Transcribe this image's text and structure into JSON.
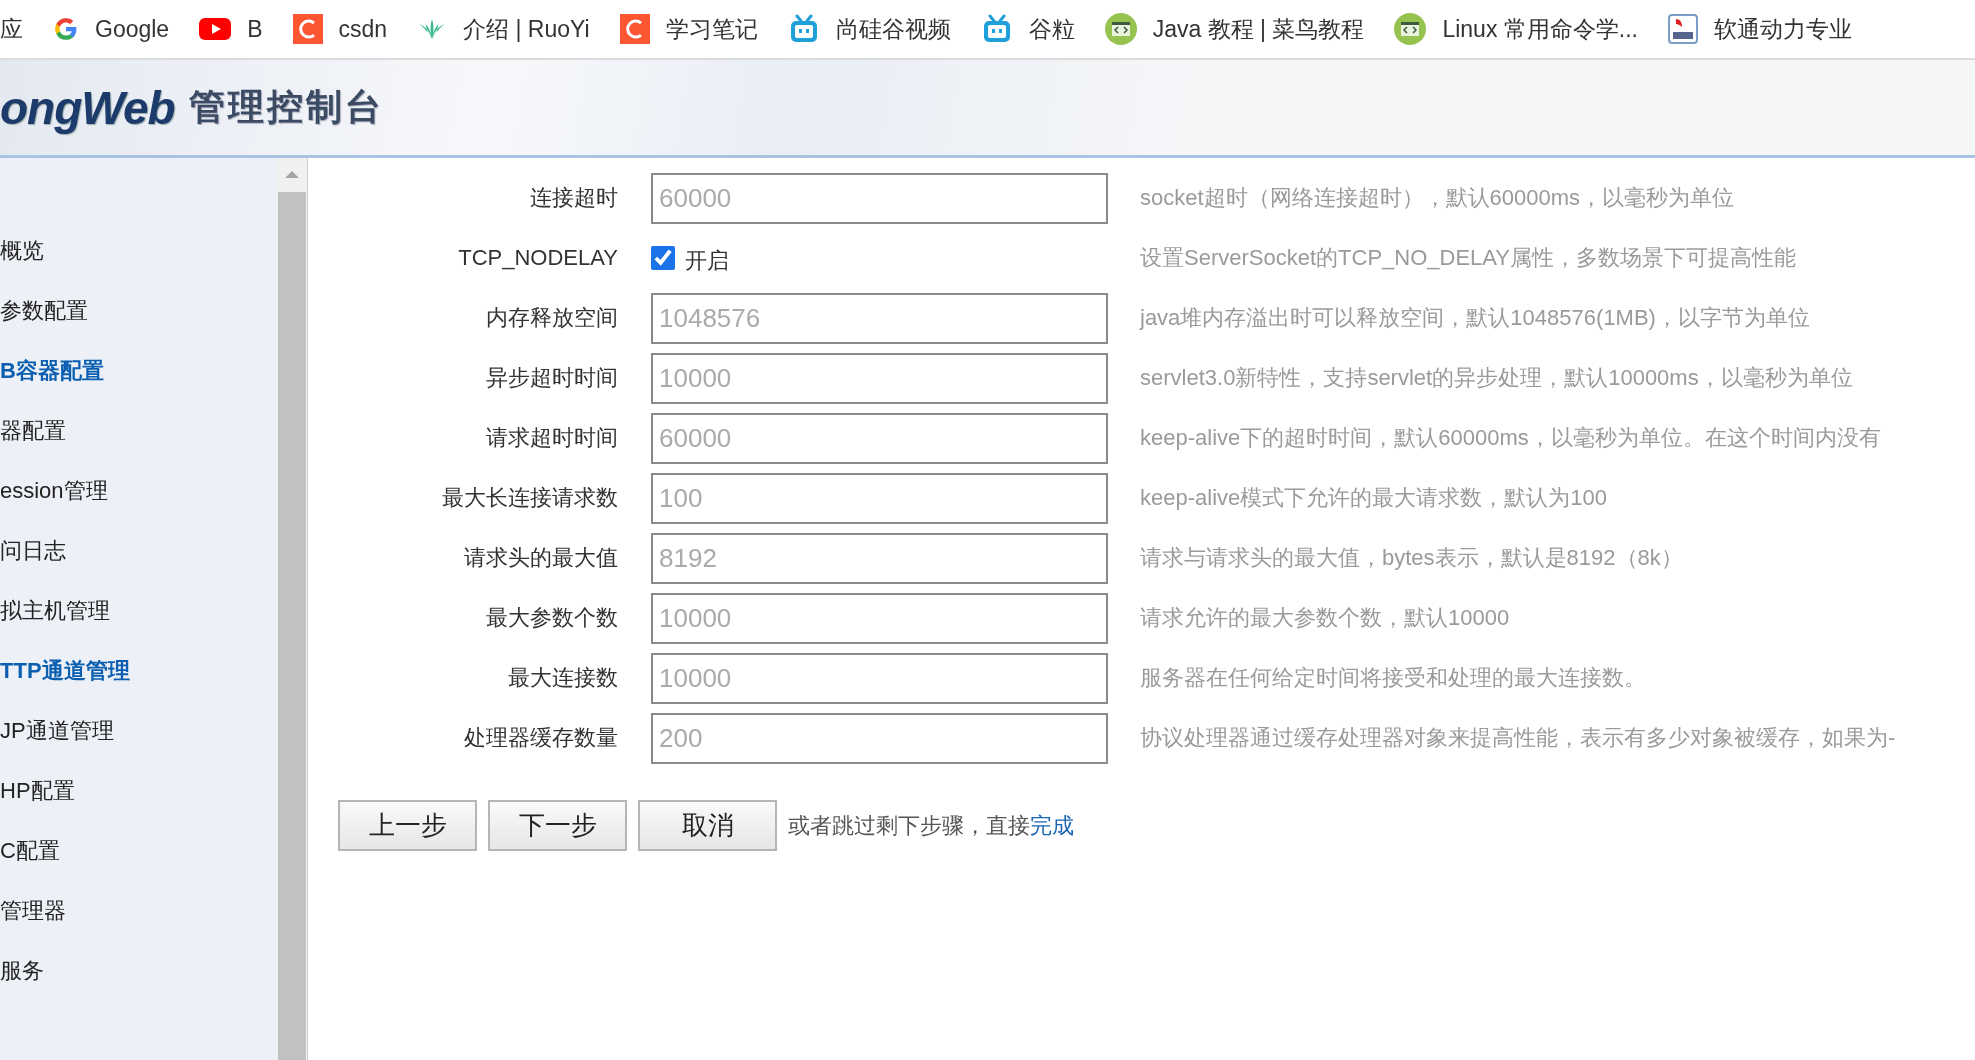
{
  "bookmarks": [
    {
      "label": "应"
    },
    {
      "label": "Google",
      "kind": "google"
    },
    {
      "label": "B",
      "kind": "youtube"
    },
    {
      "label": "csdn",
      "kind": "csdn"
    },
    {
      "label": "介绍 | RuoYi",
      "kind": "leaf"
    },
    {
      "label": "学习笔记",
      "kind": "csdn"
    },
    {
      "label": "尚硅谷视频",
      "kind": "tv"
    },
    {
      "label": "谷粒",
      "kind": "tv"
    },
    {
      "label": "Java 教程 | 菜鸟教程",
      "kind": "code"
    },
    {
      "label": "Linux 常用命令学...",
      "kind": "code"
    },
    {
      "label": "软通动力专业",
      "kind": "psa"
    }
  ],
  "header": {
    "logo": "ongWeb",
    "title": "管理控制台"
  },
  "sidebar": {
    "items": [
      {
        "label": "概览",
        "kind": "item"
      },
      {
        "label": "参数配置",
        "kind": "item"
      },
      {
        "label": "B容器配置",
        "kind": "group"
      },
      {
        "label": "器配置",
        "kind": "item"
      },
      {
        "label": "ession管理",
        "kind": "item"
      },
      {
        "label": "问日志",
        "kind": "item"
      },
      {
        "label": "拟主机管理",
        "kind": "item"
      },
      {
        "label": "TTP通道管理",
        "kind": "group"
      },
      {
        "label": "JP通道管理",
        "kind": "item"
      },
      {
        "label": "HP配置",
        "kind": "item"
      },
      {
        "label": "C配置",
        "kind": "item"
      },
      {
        "label": "管理器",
        "kind": "item"
      },
      {
        "label": "服务",
        "kind": "item"
      }
    ]
  },
  "form": {
    "rows": [
      {
        "kind": "field",
        "label": "连接超时",
        "value": "60000",
        "hint": "socket超时（网络连接超时），默认60000ms，以毫秒为单位"
      },
      {
        "kind": "checkbox",
        "label": "TCP_NODELAY",
        "checked": true,
        "option": "开启",
        "hint": "设置ServerSocket的TCP_NO_DELAY属性，多数场景下可提高性能"
      },
      {
        "kind": "field",
        "label": "内存释放空间",
        "value": "1048576",
        "hint": "java堆内存溢出时可以释放空间，默认1048576(1MB)，以字节为单位"
      },
      {
        "kind": "field",
        "label": "异步超时时间",
        "value": "10000",
        "hint": "servlet3.0新特性，支持servlet的异步处理，默认10000ms，以毫秒为单位"
      },
      {
        "kind": "field",
        "label": "请求超时时间",
        "value": "60000",
        "hint": "keep-alive下的超时时间，默认60000ms，以毫秒为单位。在这个时间内没有"
      },
      {
        "kind": "field",
        "label": "最大长连接请求数",
        "value": "100",
        "hint": "keep-alive模式下允许的最大请求数，默认为100"
      },
      {
        "kind": "field",
        "label": "请求头的最大值",
        "value": "8192",
        "hint": "请求与请求头的最大值，bytes表示，默认是8192（8k）"
      },
      {
        "kind": "field",
        "label": "最大参数个数",
        "value": "10000",
        "hint": "请求允许的最大参数个数，默认10000"
      },
      {
        "kind": "field",
        "label": "最大连接数",
        "value": "10000",
        "hint": "服务器在任何给定时间将接受和处理的最大连接数。"
      },
      {
        "kind": "field",
        "label": "处理器缓存数量",
        "value": "200",
        "hint": "协议处理器通过缓存处理器对象来提高性能，表示有多少对象被缓存，如果为-"
      }
    ]
  },
  "actions": {
    "buttons": [
      "上一步",
      "下一步",
      "取消"
    ],
    "note": "或者跳过剩下步骤，直接",
    "link": "完成"
  }
}
